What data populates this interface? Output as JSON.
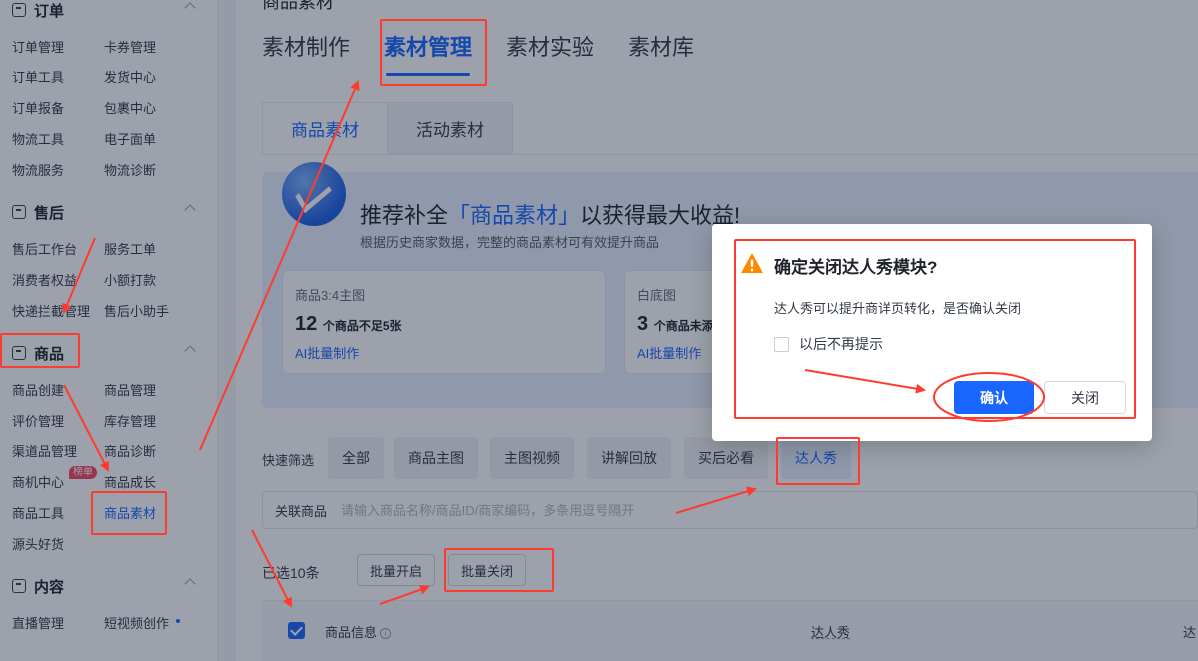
{
  "sidebar": {
    "sections": [
      {
        "title": "订单",
        "icon": "order-icon"
      },
      {
        "title": "售后",
        "icon": "aftersale-icon"
      },
      {
        "title": "商品",
        "icon": "product-icon"
      },
      {
        "title": "内容",
        "icon": "content-icon"
      }
    ],
    "order_items": [
      "订单管理",
      "卡券管理",
      "订单工具",
      "发货中心",
      "订单报备",
      "包裹中心",
      "物流工具",
      "电子面单",
      "物流服务",
      "物流诊断"
    ],
    "aftersale_items": [
      "售后工作台",
      "服务工单",
      "消费者权益",
      "小额打款",
      "快递拦截管理",
      "售后小助手"
    ],
    "product_items": [
      "商品创建",
      "商品管理",
      "评价管理",
      "库存管理",
      "渠道品管理",
      "商品诊断",
      "商机中心",
      "商品成长",
      "商品工具",
      "商品素材",
      "源头好货"
    ],
    "product_badge": "榜单",
    "content_items": [
      "直播管理",
      "短视频创作"
    ]
  },
  "main": {
    "breadcrumb": "商品素材",
    "tabs": [
      "素材制作",
      "素材管理",
      "素材实验",
      "素材库"
    ],
    "subtabs": [
      "商品素材",
      "活动素材"
    ],
    "banner": {
      "title_prefix": "推荐补全",
      "title_highlight": "「商品素材」",
      "title_suffix": "以获得最大收益!",
      "subtitle": "根据历史商家数据，完整的商品素材可有效提升商品",
      "cards": [
        {
          "label": "商品3:4主图",
          "num": "12",
          "unit": "个商品不足5张",
          "link": "AI批量制作"
        },
        {
          "label": "白底图",
          "num": "3",
          "unit": "个商品未添加",
          "link": "AI批量制作"
        }
      ]
    },
    "filter": {
      "label": "快速筛选",
      "chips": [
        "全部",
        "商品主图",
        "主图视频",
        "讲解回放",
        "买后必看",
        "达人秀"
      ]
    },
    "search": {
      "label": "关联商品",
      "placeholder": "请输入商品名称/商品ID/商家编码，多条用逗号隔开"
    },
    "selection": {
      "count_text": "已选10条",
      "batch_open": "批量开启",
      "batch_close": "批量关闭"
    },
    "table": {
      "col_product": "商品信息",
      "col_daren": "达人秀",
      "col_more": "达"
    }
  },
  "dialog": {
    "title": "确定关闭达人秀模块?",
    "body": "达人秀可以提升商详页转化，是否确认关闭",
    "checkbox_label": "以后不再提示",
    "confirm": "确认",
    "close": "关闭"
  },
  "colors": {
    "primary": "#1966ff",
    "annotation": "#ff3b30",
    "warning": "#ff8a00"
  }
}
